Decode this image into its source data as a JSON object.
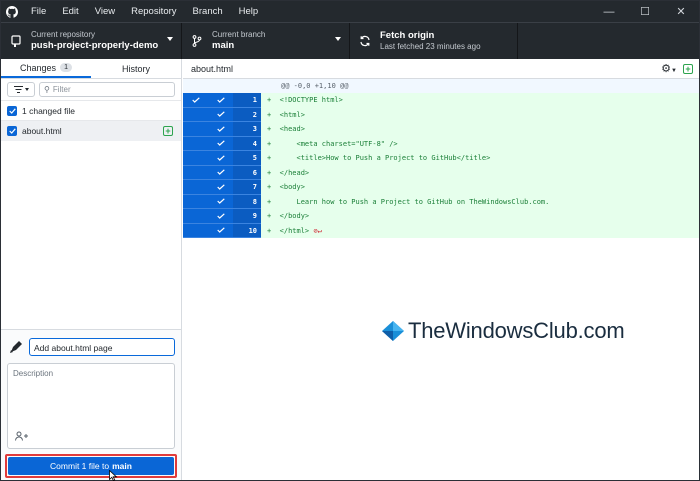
{
  "titlebar": {
    "menus": [
      "File",
      "Edit",
      "View",
      "Repository",
      "Branch",
      "Help"
    ],
    "controls": {
      "minimize": "—",
      "maximize": "☐",
      "close": "✕"
    }
  },
  "toolbar": {
    "repo": {
      "small": "Current repository",
      "big": "push-project-properly-demo"
    },
    "branch": {
      "small": "Current branch",
      "big": "main"
    },
    "fetch": {
      "small": "Last fetched 23 minutes ago",
      "big": "Fetch origin"
    }
  },
  "sidebar": {
    "tabs": {
      "changes": "Changes",
      "changes_count": "1",
      "history": "History"
    },
    "filter_placeholder": "Filter",
    "changed_files": "1 changed file",
    "file": "about.html"
  },
  "commit": {
    "summary": "Add about.html page",
    "description_placeholder": "Description",
    "button_prefix": "Commit 1 file to",
    "button_branch": "main"
  },
  "diff": {
    "filename": "about.html",
    "hunk": "@@ -0,0 +1,10 @@",
    "lines": [
      {
        "n": "1",
        "t": "+  <!DOCTYPE html>"
      },
      {
        "n": "2",
        "t": "+  <html>"
      },
      {
        "n": "3",
        "t": "+  <head>"
      },
      {
        "n": "4",
        "t": "+      <meta charset=\"UTF-8\" />"
      },
      {
        "n": "5",
        "t": "+      <title>How to Push a Project to GitHub</title>"
      },
      {
        "n": "6",
        "t": "+  </head>"
      },
      {
        "n": "7",
        "t": "+  <body>"
      },
      {
        "n": "8",
        "t": "+      Learn how to Push a Project to GitHub on TheWindowsClub.com."
      },
      {
        "n": "9",
        "t": "+  </body>"
      },
      {
        "n": "10",
        "t": "+  </html>"
      }
    ]
  },
  "watermark": "TheWindowsClub.com",
  "colors": {
    "accent": "#0a66d6",
    "titlebar": "#24292e",
    "added_bg": "#e6ffec",
    "added_text": "#1a7f37",
    "highlight": "#e03b3b"
  }
}
